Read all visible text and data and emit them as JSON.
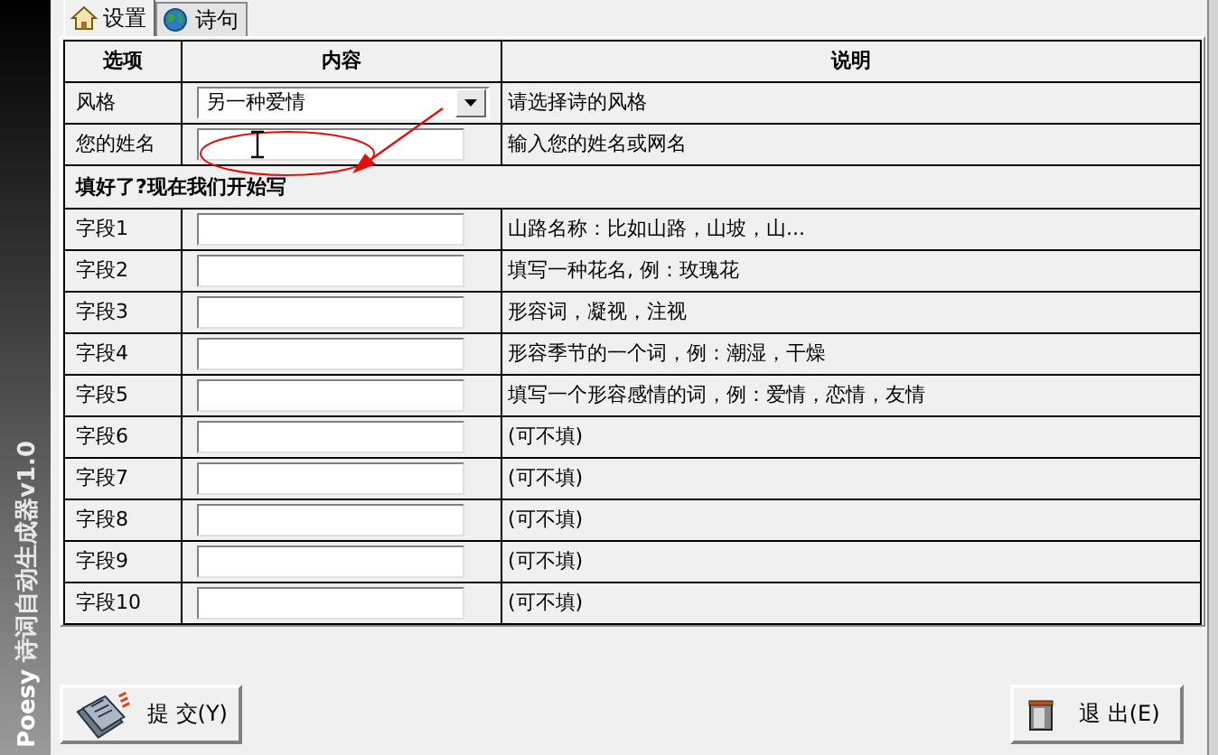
{
  "sidebar": {
    "title": "Poesy",
    "subtitle": "诗词自动生成器v1.0"
  },
  "tabs": [
    {
      "label": "设置",
      "selected": true
    },
    {
      "label": "诗句",
      "selected": false
    }
  ],
  "table": {
    "columns": [
      "选项",
      "内容",
      "说明"
    ],
    "rows": [
      {
        "kind": "select",
        "label": "风格",
        "value": "另一种爱情",
        "hint": "请选择诗的风格"
      },
      {
        "kind": "input",
        "label": "您的姓名",
        "hint": "输入您的姓名或网名"
      },
      {
        "kind": "section",
        "label": "填好了?现在我们开始写"
      },
      {
        "kind": "input",
        "label": "字段1",
        "hint": "山路名称：比如山路，山坡，山..."
      },
      {
        "kind": "input",
        "label": "字段2",
        "hint": "填写一种花名, 例：玫瑰花"
      },
      {
        "kind": "input",
        "label": "字段3",
        "hint": "形容词，凝视，注视"
      },
      {
        "kind": "input",
        "label": "字段4",
        "hint": "形容季节的一个词，例：潮湿，干燥"
      },
      {
        "kind": "input",
        "label": "字段5",
        "hint": "填写一个形容感情的词，例：爱情，恋情，友情"
      },
      {
        "kind": "input",
        "label": "字段6",
        "hint": "(可不填)"
      },
      {
        "kind": "input",
        "label": "字段7",
        "hint": "(可不填)"
      },
      {
        "kind": "input",
        "label": "字段8",
        "hint": "(可不填)"
      },
      {
        "kind": "input",
        "label": "字段9",
        "hint": "(可不填)"
      },
      {
        "kind": "input",
        "label": "字段10",
        "hint": "(可不填)"
      }
    ]
  },
  "buttons": [
    {
      "label": "提 交(Y)"
    },
    {
      "label": "退 出(E)"
    }
  ]
}
